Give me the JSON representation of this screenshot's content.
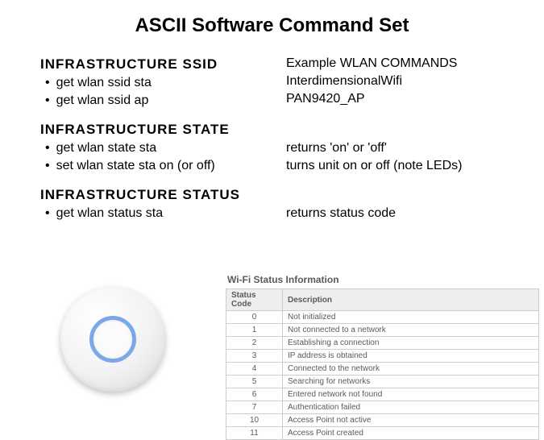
{
  "title": "ASCII Software Command Set",
  "sections": {
    "ssid": {
      "heading": "INFRASTRUCTURE  SSID",
      "items": [
        "get wlan ssid sta",
        "get wlan ssid ap"
      ],
      "example_header": "Example WLAN COMMANDS",
      "examples": [
        "InterdimensionalWifi",
        "PAN9420_AP"
      ]
    },
    "state": {
      "heading": "INFRASTRUCTURE  STATE",
      "items": [
        "get wlan state sta",
        "set wlan state sta on (or off)"
      ],
      "descs": [
        "returns 'on' or 'off'",
        "turns unit on or off (note LEDs)"
      ]
    },
    "status": {
      "heading": "INFRASTRUCTURE  STATUS",
      "items": [
        "get wlan status sta"
      ],
      "descs": [
        "returns status code"
      ]
    }
  },
  "table": {
    "title": "Wi-Fi Status Information",
    "headers": [
      "Status Code",
      "Description"
    ],
    "rows": [
      {
        "code": "0",
        "desc": "Not initialized"
      },
      {
        "code": "1",
        "desc": "Not connected to a network"
      },
      {
        "code": "2",
        "desc": "Establishing a connection"
      },
      {
        "code": "3",
        "desc": "IP address is obtained"
      },
      {
        "code": "4",
        "desc": "Connected to the network"
      },
      {
        "code": "5",
        "desc": "Searching for networks"
      },
      {
        "code": "6",
        "desc": "Entered network not found"
      },
      {
        "code": "7",
        "desc": "Authentication failed"
      },
      {
        "code": "10",
        "desc": "Access Point not active"
      },
      {
        "code": "11",
        "desc": "Access Point created"
      }
    ]
  }
}
